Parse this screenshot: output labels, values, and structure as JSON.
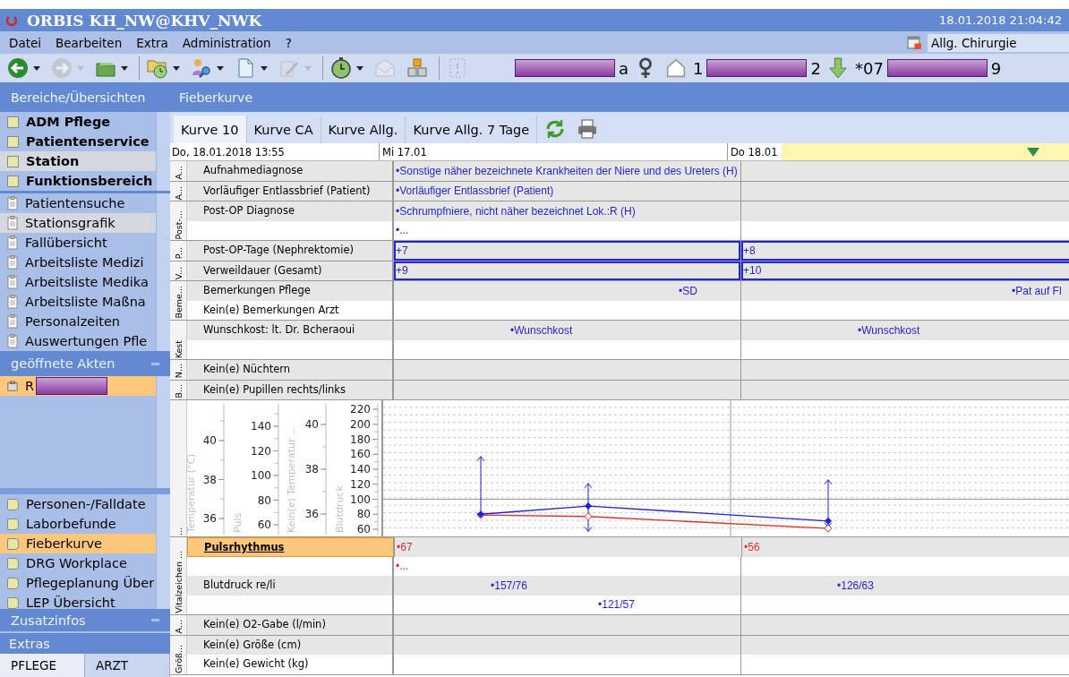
{
  "window": {
    "title": "ORBIS KH_NW@KHV_NWK",
    "datetime": "18.01.2018 21:04:42"
  },
  "menu": [
    "Datei",
    "Bearbeiten",
    "Extra",
    "Administration",
    "?"
  ],
  "department": {
    "value": "Allg. Chirurgie"
  },
  "toolbar": [
    {
      "kind": "back",
      "dropdown": true,
      "disabled": false,
      "separator": false
    },
    {
      "kind": "forward",
      "dropdown": true,
      "disabled": true,
      "separator": false
    },
    {
      "kind": "folder",
      "dropdown": true,
      "disabled": false,
      "separator": true
    },
    {
      "kind": "folder-clock",
      "dropdown": true,
      "disabled": false,
      "separator": false
    },
    {
      "kind": "person-search",
      "dropdown": true,
      "disabled": false,
      "separator": false
    },
    {
      "kind": "document",
      "dropdown": true,
      "disabled": false,
      "separator": false
    },
    {
      "kind": "edit",
      "dropdown": true,
      "disabled": true,
      "separator": true
    },
    {
      "kind": "stopwatch",
      "dropdown": true,
      "disabled": false,
      "separator": false
    },
    {
      "kind": "mail",
      "dropdown": false,
      "disabled": true,
      "separator": false
    },
    {
      "kind": "cubes",
      "dropdown": false,
      "disabled": false,
      "separator": true
    },
    {
      "kind": "placeholder",
      "dropdown": false,
      "disabled": true,
      "separator": false
    }
  ],
  "patient": [
    {
      "kind": "redacted"
    },
    {
      "kind": "text",
      "text": "a"
    },
    {
      "kind": "female"
    },
    {
      "kind": "house"
    },
    {
      "kind": "text",
      "text": "1"
    },
    {
      "kind": "redacted"
    },
    {
      "kind": "text",
      "text": "2"
    },
    {
      "kind": "arrow-down"
    },
    {
      "kind": "text",
      "text": "*07"
    },
    {
      "kind": "redacted"
    },
    {
      "kind": "text",
      "text": "9"
    }
  ],
  "breadcrumb": {
    "area": "Bereiche/Übersichten",
    "page": "Fieberkurve"
  },
  "sidebar": {
    "areas": [
      {
        "label": "ADM Pflege",
        "selected": false
      },
      {
        "label": "Patientenservice",
        "selected": false
      },
      {
        "label": "Station",
        "selected": true
      },
      {
        "label": "Funktionsbereich",
        "selected": false
      }
    ],
    "functions": [
      {
        "label": "Patientensuche",
        "selected": false
      },
      {
        "label": "Stationsgrafik",
        "selected": true
      },
      {
        "label": "Fallübersicht",
        "selected": false
      },
      {
        "label": "Arbeitsliste Medizi",
        "selected": false
      },
      {
        "label": "Arbeitsliste Medika",
        "selected": false
      },
      {
        "label": "Arbeitsliste Maßna",
        "selected": false
      },
      {
        "label": "Personalzeiten",
        "selected": false
      },
      {
        "label": "Auswertungen Pfle",
        "selected": false
      }
    ],
    "open_files": {
      "title": "geöffnete Akten",
      "items": [
        {
          "label": "R",
          "selected": true
        }
      ]
    },
    "views": [
      {
        "label": "Personen-/Falldate",
        "selected": false
      },
      {
        "label": "Laborbefunde",
        "selected": false
      },
      {
        "label": "Fieberkurve",
        "selected": true
      },
      {
        "label": "DRG Workplace",
        "selected": false
      },
      {
        "label": "Pflegeplanung Über",
        "selected": false
      },
      {
        "label": "LEP Übersicht",
        "selected": false
      }
    ],
    "extra_info": {
      "title": "Zusatzinfos"
    },
    "extras": {
      "title": "Extras"
    },
    "roles": [
      {
        "label": "PFLEGE",
        "selected": true
      },
      {
        "label": "ARZT",
        "selected": false
      }
    ]
  },
  "tabs": [
    {
      "label": "Kurve 10",
      "selected": true
    },
    {
      "label": "Kurve CA",
      "selected": false
    },
    {
      "label": "Kurve Allg.",
      "selected": false
    },
    {
      "label": "Kurve Allg. 7 Tage",
      "selected": false
    }
  ],
  "timestamp": "Do, 18.01.2018 13:55",
  "days": [
    {
      "label": "Mi 17.01",
      "current": false
    },
    {
      "label": "Do 18.01",
      "current": true
    }
  ],
  "groups": [
    {
      "kind": "rows",
      "label": "A...",
      "rows": [
        {
          "label": "Aufnahmediagnose",
          "selected": false,
          "outlined": false,
          "day_1": [
            {
              "text": "•Sonstige näher bezeichnete Krankheiten der Niere und des Ureters (H)",
              "color": "#2626d9"
            }
          ]
        }
      ]
    },
    {
      "kind": "rows",
      "label": "A...",
      "rows": [
        {
          "label": "Vorläufiger Entlassbrief (Patient)",
          "selected": false,
          "outlined": false,
          "day_1": [
            {
              "text": "•Vorläufiger Entlassbrief (Patient)",
              "color": "#2626d9"
            }
          ]
        }
      ]
    },
    {
      "kind": "rows",
      "label": "Post-...",
      "rows": [
        {
          "label": "Post-OP Diagnose",
          "selected": false,
          "outlined": false,
          "day_1": [
            {
              "text": "•Schrumpfniere, nicht näher bezeichnet Lok.:R (H)",
              "color": "#2626d9"
            }
          ]
        },
        {
          "selected": false,
          "outlined": false,
          "day_1": [
            {
              "text": "•...",
              "color": "#2626d9"
            }
          ]
        }
      ]
    },
    {
      "kind": "rows",
      "label": "P...",
      "rows": [
        {
          "label": "Post-OP-Tage (Nephrektomie)",
          "selected": false,
          "outlined": true,
          "day_1": [
            {
              "text": "+7",
              "color": "#2626d9"
            }
          ],
          "day_2": [
            {
              "text": "+8",
              "color": "#2626d9"
            }
          ]
        }
      ]
    },
    {
      "kind": "rows",
      "label": "V...",
      "rows": [
        {
          "label": "Verweildauer (Gesamt)",
          "selected": false,
          "outlined": true,
          "day_1": [
            {
              "text": "+9",
              "color": "#2626d9"
            }
          ],
          "day_2": [
            {
              "text": "+10",
              "color": "#2626d9"
            }
          ]
        }
      ]
    },
    {
      "kind": "rows",
      "label": "Beme...",
      "rows": [
        {
          "label": "Bemerkungen Pflege",
          "selected": false,
          "outlined": false,
          "day_1": [
            {
              "text": "•SD",
              "color": "#2626d9"
            }
          ],
          "day_2": [
            {
              "text": "•Pat auf Fl",
              "color": "#2626d9"
            }
          ]
        },
        {
          "label": "Kein(e) Bemerkungen Arzt",
          "selected": false,
          "outlined": false
        }
      ]
    },
    {
      "kind": "rows",
      "label": "Kest",
      "rows": [
        {
          "label": "Wunschkost: lt. Dr. Bcheraoui",
          "selected": false,
          "outlined": false,
          "day_1": [
            {
              "text": "•Wunschkost",
              "color": "#2626d9"
            }
          ],
          "day_2": [
            {
              "text": "•Wunschkost",
              "color": "#2626d9"
            }
          ]
        },
        {
          "selected": false,
          "outlined": false
        }
      ]
    },
    {
      "kind": "rows",
      "label": "N...",
      "rows": [
        {
          "label": "Kein(e) Nüchtern",
          "selected": false,
          "outlined": false
        }
      ]
    },
    {
      "kind": "rows",
      "label": "B...",
      "rows": [
        {
          "label": "Kein(e) Pupillen rechts/links",
          "selected": false,
          "outlined": false
        }
      ]
    },
    {
      "kind": "chart",
      "label": "...",
      "axes": [
        {
          "name": "Temperatur (°C)",
          "ticks": [
            "40",
            "38",
            "36"
          ]
        },
        {
          "name": "Puls",
          "ticks": [
            "140",
            "120",
            "100",
            "80",
            "60"
          ]
        },
        {
          "name": "Kein(e) Temperatur ...",
          "ticks": [
            "40",
            "38",
            "36"
          ]
        },
        {
          "name": "Blutdruck",
          "ticks": [
            "220",
            "200",
            "180",
            "160",
            "140",
            "120",
            "100",
            "80",
            "60"
          ]
        }
      ]
    },
    {
      "kind": "rows",
      "label": "Vitalzeichen ...",
      "rows": [
        {
          "label": "Pulsrhythmus",
          "selected": true,
          "outlined": false,
          "day_1": [
            {
              "text": "•67",
              "color": "#f02b2b"
            }
          ],
          "day_2": [
            {
              "text": "•56",
              "color": "#f02b2b"
            }
          ]
        },
        {
          "selected": false,
          "outlined": false,
          "day_1": [
            {
              "text": "•...",
              "color": "#f02b2b"
            }
          ]
        },
        {
          "label": "Blutdruck re/li",
          "selected": false,
          "outlined": false,
          "day_1": [
            {
              "text": "•157/76",
              "color": "#2626d9"
            }
          ],
          "day_2": [
            {
              "text": "•126/63",
              "color": "#2626d9"
            }
          ]
        },
        {
          "selected": false,
          "outlined": false,
          "day_1": [
            {
              "text": "•121/57",
              "color": "#2626d9"
            }
          ]
        }
      ]
    },
    {
      "kind": "rows",
      "label": "A...",
      "rows": [
        {
          "label": "Kein(e) O2-Gabe (l/min)",
          "selected": false,
          "outlined": false
        }
      ]
    },
    {
      "kind": "rows",
      "label": "Größ...",
      "rows": [
        {
          "label": "Kein(e) Größe (cm)",
          "selected": false,
          "outlined": false
        },
        {
          "label": "Kein(e) Gewicht (kg)",
          "selected": false,
          "outlined": false
        }
      ]
    }
  ]
}
